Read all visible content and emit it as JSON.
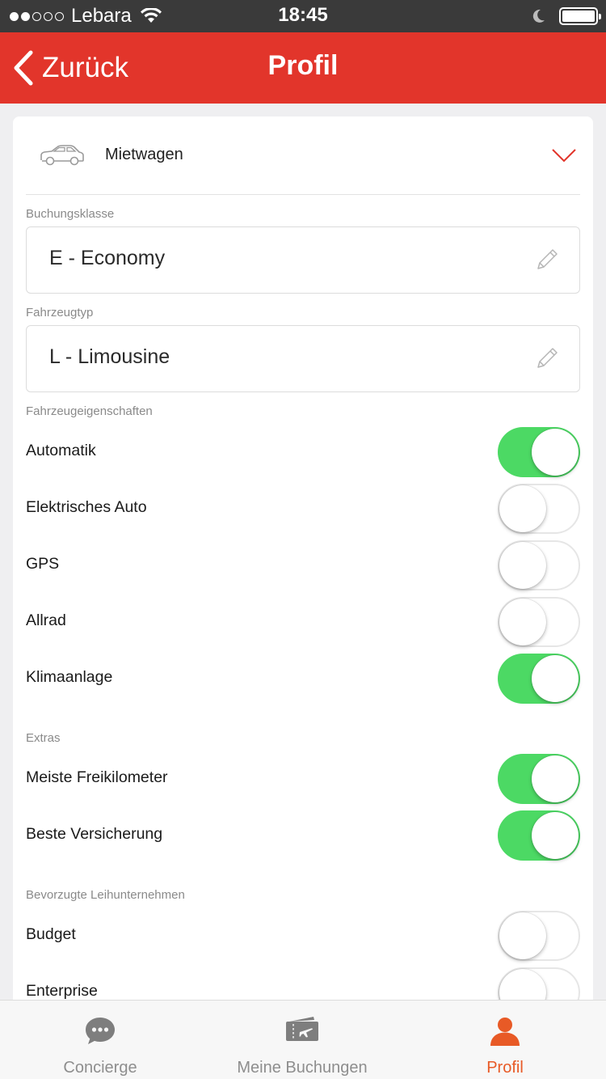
{
  "status_bar": {
    "signal_dots_filled": 2,
    "signal_dots_total": 5,
    "carrier": "Lebara",
    "time": "18:45",
    "icons": [
      "wifi-icon",
      "moon-icon",
      "battery-icon"
    ]
  },
  "nav": {
    "back_label": "Zurück",
    "title": "Profil"
  },
  "category": {
    "icon": "car-icon",
    "label": "Mietwagen",
    "expanded": true
  },
  "booking_class": {
    "label": "Buchungsklasse",
    "value": "E - Economy"
  },
  "vehicle_type": {
    "label": "Fahrzeugtyp",
    "value": "L - Limousine"
  },
  "features": {
    "label": "Fahrzeugeigenschaften",
    "items": [
      {
        "label": "Automatik",
        "on": true
      },
      {
        "label": "Elektrisches Auto",
        "on": false
      },
      {
        "label": "GPS",
        "on": false
      },
      {
        "label": "Allrad",
        "on": false
      },
      {
        "label": "Klimaanlage",
        "on": true
      }
    ]
  },
  "extras": {
    "label": "Extras",
    "items": [
      {
        "label": "Meiste Freikilometer",
        "on": true
      },
      {
        "label": "Beste Versicherung",
        "on": true
      }
    ]
  },
  "companies": {
    "label": "Bevorzugte Leihunternehmen",
    "items": [
      {
        "label": "Budget",
        "on": false
      },
      {
        "label": "Enterprise",
        "on": false
      }
    ]
  },
  "tabs": [
    {
      "label": "Concierge",
      "icon": "chat-bubble-icon",
      "active": false
    },
    {
      "label": "Meine Buchungen",
      "icon": "ticket-icon",
      "active": false
    },
    {
      "label": "Profil",
      "icon": "person-icon",
      "active": true
    }
  ],
  "colors": {
    "brand_red": "#e2352b",
    "toggle_on": "#4cd964",
    "tab_active": "#e85a26",
    "tab_inactive": "#8e8e8e"
  }
}
